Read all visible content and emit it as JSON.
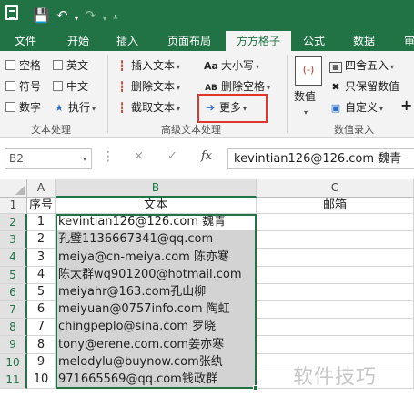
{
  "titlebar": {
    "undo_icon": "undo-icon",
    "redo_icon": "redo-icon",
    "customize_icon": "customize-qat-icon",
    "accent": "#217346"
  },
  "tabs": [
    "文件",
    "开始",
    "插入",
    "页面布局",
    "方方格子",
    "公式",
    "数据",
    "审阅"
  ],
  "active_tab": "方方格子",
  "ribbon": {
    "text_group": {
      "checkboxes": [
        "空格",
        "英文",
        "符号",
        "中文",
        "数字"
      ],
      "execute_label": "执行",
      "group_label": "文本处理"
    },
    "advanced_group": {
      "insert_text": "插入文本",
      "delete_text": "删除文本",
      "extract_text": "截取文本",
      "case_label": "大小写",
      "delete_space": "删除空格",
      "more_label": "更多",
      "group_label": "高级文本处理"
    },
    "value_group": {
      "value_label": "数值",
      "round_label": "四舍五入",
      "keep_value": "只保留数值",
      "custom_label": "自定义",
      "group_label": "数值录入"
    }
  },
  "formula_bar": {
    "name_box": "B2",
    "cancel_icon": "×",
    "enter_icon": "✓",
    "fx_label": "fx",
    "content": "kevintian126@126.com 魏青"
  },
  "sheet": {
    "columns": [
      "A",
      "B",
      "C"
    ],
    "header_row": {
      "a": "序号",
      "b": "文本",
      "c": "邮箱"
    },
    "rows": [
      {
        "n": "1",
        "text": "kevintian126@126.com 魏青"
      },
      {
        "n": "2",
        "text": "孔璧1136667341@qq.com"
      },
      {
        "n": "3",
        "text": " meiya@cn-meiya.com 陈亦寒"
      },
      {
        "n": "4",
        "text": "陈太群wq901200@hotmail.com"
      },
      {
        "n": "5",
        "text": "meiyahr@163.com孔山柳"
      },
      {
        "n": "6",
        "text": "meiyuan@0757info.com 陶虹"
      },
      {
        "n": "7",
        "text": "chingpeplo@sina.com 罗晓"
      },
      {
        "n": "8",
        "text": "tony@erene.com.com姜亦寒"
      },
      {
        "n": "9",
        "text": "melodylu@buynow.com张纨"
      },
      {
        "n": "10",
        "text": "971665569@qq.com钱政群"
      }
    ],
    "row_numbers": [
      "1",
      "2",
      "3",
      "4",
      "5",
      "6",
      "7",
      "8",
      "9",
      "10",
      "11"
    ]
  },
  "watermark": "软件技巧"
}
